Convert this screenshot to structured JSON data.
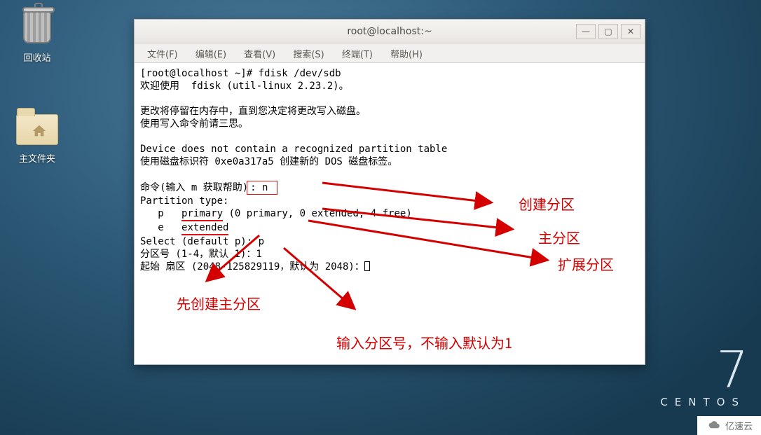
{
  "desktop": {
    "trash_label": "回收站",
    "home_label": "主文件夹"
  },
  "centos": {
    "seven": "7",
    "word": "CENTOS"
  },
  "watermark": "亿速云",
  "window": {
    "title": "root@localhost:~",
    "menu": {
      "file": "文件(F)",
      "edit": "编辑(E)",
      "view": "查看(V)",
      "search": "搜索(S)",
      "term": "终端(T)",
      "help": "帮助(H)"
    },
    "btn": {
      "min": "—",
      "max": "▢",
      "close": "✕"
    }
  },
  "term": {
    "l1": "[root@localhost ~]# fdisk /dev/sdb",
    "l2": "欢迎使用  fdisk (util-linux 2.23.2)。",
    "l3": "",
    "l4": "更改将停留在内存中，直到您决定将更改写入磁盘。",
    "l5": "使用写入命令前请三思。",
    "l6": "",
    "l7": "Device does not contain a recognized partition table",
    "l8": "使用磁盘标识符 0xe0a317a5 创建新的 DOS 磁盘标签。",
    "l9": "",
    "l10a": "命令(输入 m 获取帮助)",
    "l10b": ": n ",
    "l11": "Partition type:",
    "l12a": "   p   ",
    "l12b": "primary",
    "l12c": " (0 primary, 0 extended, 4 free)",
    "l13a": "   e   ",
    "l13b": "extended",
    "l14": "Select (default p): p",
    "l15": "分区号 (1-4，默认 1)：1",
    "l16": "起始 扇区 (2048-125829119，默认为 2048)："
  },
  "ann": {
    "a1": "创建分区",
    "a2": "主分区",
    "a3": "扩展分区",
    "a4": "先创建主分区",
    "a5": "输入分区号，不输入默认为1"
  }
}
